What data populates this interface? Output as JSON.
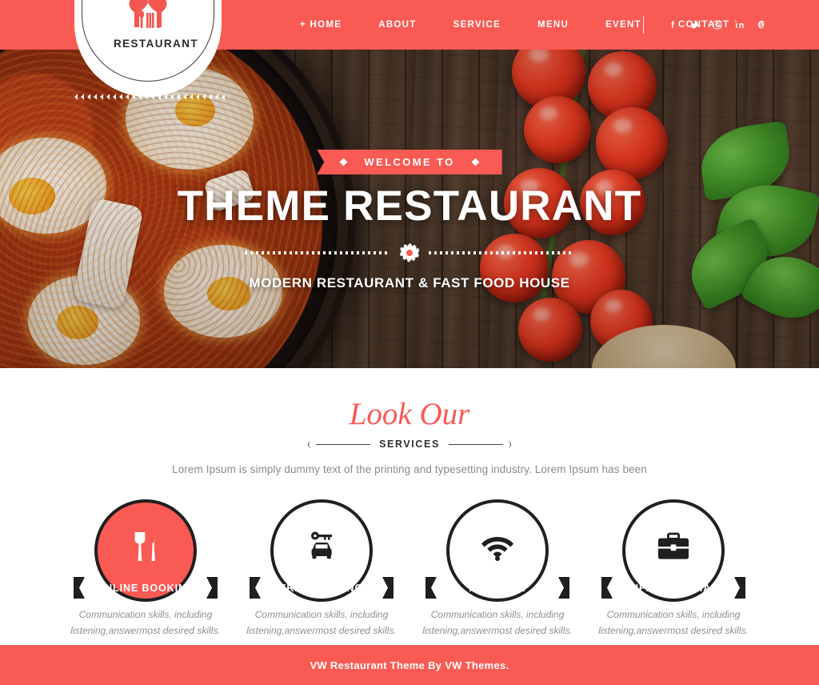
{
  "theme": {
    "brand_red": "#f95a53",
    "dark": "#1f1f1f",
    "white": "#ffffff",
    "muted_text": "#8b8b8b"
  },
  "header": {
    "logo": {
      "name": "RESTAURANT",
      "icon": "chef-hat-heart-utensils"
    },
    "nav": [
      {
        "label": "+ HOME",
        "active": true
      },
      {
        "label": "ABOUT",
        "active": false
      },
      {
        "label": "SERVICE",
        "active": false
      },
      {
        "label": "MENU",
        "active": false
      },
      {
        "label": "EVENT",
        "active": false
      },
      {
        "label": "CONTACT",
        "active": false
      }
    ],
    "socials": [
      {
        "name": "facebook-icon",
        "label": "Facebook"
      },
      {
        "name": "twitter-icon",
        "label": "Twitter"
      },
      {
        "name": "instagram-icon",
        "label": "Instagram"
      },
      {
        "name": "linkedin-icon",
        "label": "LinkedIn"
      },
      {
        "name": "pinterest-icon",
        "label": "Pinterest"
      }
    ]
  },
  "hero": {
    "ribbon_label": "WELCOME TO",
    "title": "THEME RESTAURANT",
    "subtitle": "MODERN RESTAURANT & FAST FOOD HOUSE",
    "image_description": "Shakshuka eggs in tomato sauce in a cast iron skillet on a wooden table with cherry tomatoes on the vine and fresh basil"
  },
  "services": {
    "heading_script": "Look Our",
    "heading_sub": "SERVICES",
    "description": "Lorem Ipsum is simply dummy text of the printing and typesetting industry. Lorem Ipsum has been",
    "cards": [
      {
        "label": "ONLINE BOOKING",
        "icon": "fork-knife-icon",
        "highlighted": true,
        "text": "Communication skills, including listening,answermost desired skills."
      },
      {
        "label": "FREE PARKING",
        "icon": "car-key-icon",
        "highlighted": false,
        "text": "Communication skills, including listening,answermost desired skills."
      },
      {
        "label": "FREE WIFI",
        "icon": "wifi-icon",
        "highlighted": false,
        "text": "Communication skills, including listening,answermost desired skills."
      },
      {
        "label": "CONFERENCE HALLS",
        "icon": "briefcase-icon",
        "highlighted": false,
        "text": "Communication skills, including listening,answermost desired skills."
      }
    ]
  },
  "footer": {
    "text": "VW Restaurant Theme By VW Themes."
  }
}
